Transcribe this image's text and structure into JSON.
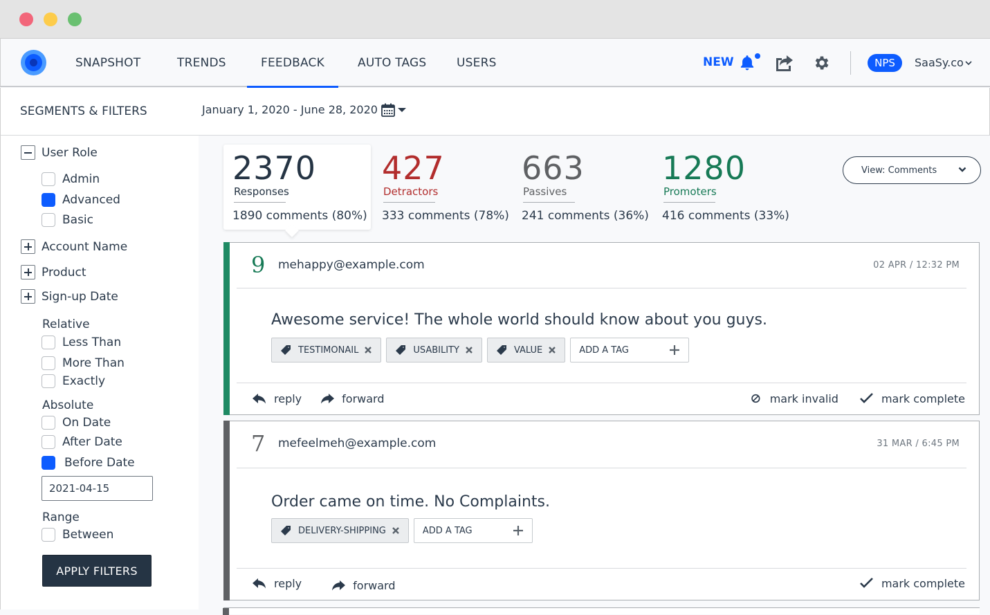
{
  "window": {
    "controls": [
      "close",
      "minimize",
      "maximize"
    ]
  },
  "nav": {
    "logo": "app-logo",
    "tabs": [
      {
        "label": "SNAPSHOT",
        "active": false
      },
      {
        "label": "TRENDS",
        "active": false
      },
      {
        "label": "FEEDBACK",
        "active": true
      },
      {
        "label": "AUTO TAGS",
        "active": false
      },
      {
        "label": "USERS",
        "active": false
      }
    ],
    "new_label": "NEW",
    "icons": [
      "bell-icon",
      "share-icon",
      "gear-icon"
    ],
    "nps_badge": "NPS",
    "company": "SaaSy.co",
    "accent_color": "#0d5cff"
  },
  "filterbar": {
    "title": "SEGMENTS & FILTERS",
    "date_range": "January 1, 2020 - June 28, 2020"
  },
  "sidebar": {
    "user_role": {
      "label": "User Role",
      "expanded": true,
      "options": [
        {
          "label": "Admin",
          "checked": false
        },
        {
          "label": "Advanced",
          "checked": true
        },
        {
          "label": "Basic",
          "checked": false
        }
      ]
    },
    "account_name": {
      "label": "Account Name",
      "expanded": false
    },
    "product": {
      "label": "Product",
      "expanded": false
    },
    "signup_date": {
      "label": "Sign-up Date",
      "expanded": false,
      "relative": {
        "label": "Relative",
        "options": [
          {
            "label": "Less Than",
            "checked": false
          },
          {
            "label": "More Than",
            "checked": false
          },
          {
            "label": "Exactly",
            "checked": false
          }
        ]
      },
      "absolute": {
        "label": "Absolute",
        "options": [
          {
            "label": "On Date",
            "checked": false
          },
          {
            "label": "After Date",
            "checked": false
          },
          {
            "label": "Before Date",
            "checked": true
          }
        ],
        "date_value": "2021-04-15"
      },
      "range": {
        "label": "Range",
        "options": [
          {
            "label": "Between",
            "checked": false
          }
        ]
      }
    },
    "apply_label": "APPLY FILTERS"
  },
  "stats": {
    "responses": {
      "value": "2370",
      "label": "Responses",
      "comments": "1890 comments (80%)",
      "color": "#253444"
    },
    "detractors": {
      "value": "427",
      "label": "Detractors",
      "comments": "333 comments (78%)",
      "color": "#b22d2d"
    },
    "passives": {
      "value": "663",
      "label": "Passives",
      "comments": "241 comments (36%)",
      "color": "#5f6164"
    },
    "promoters": {
      "value": "1280",
      "label": "Promoters",
      "comments": "416 comments (33%)",
      "color": "#177a56"
    }
  },
  "view_select": {
    "label": "View:  Comments"
  },
  "feedback": [
    {
      "score": "9",
      "score_color": "#177a56",
      "stripe_color": "#1e8a63",
      "email": "mehappy@example.com",
      "time": "02 APR / 12:32 PM",
      "text": "Awesome service! The whole world should know about you guys.",
      "tags": [
        "TESTIMONAIL",
        "USABILITY",
        "VALUE"
      ],
      "add_tag": "ADD A TAG",
      "actions": {
        "reply": "reply",
        "forward": "forward",
        "mark_invalid": "mark invalid",
        "mark_complete": "mark complete"
      }
    },
    {
      "score": "7",
      "score_color": "#5f6164",
      "stripe_color": "#5f6164",
      "email": "mefeelmeh@example.com",
      "time": "31 MAR / 6:45 PM",
      "text": "Order came on time. No Complaints.",
      "tags": [
        "DELIVERY-SHIPPING"
      ],
      "add_tag": "ADD A TAG",
      "actions": {
        "reply": "reply",
        "forward": "forward",
        "mark_complete": "mark complete"
      }
    }
  ]
}
